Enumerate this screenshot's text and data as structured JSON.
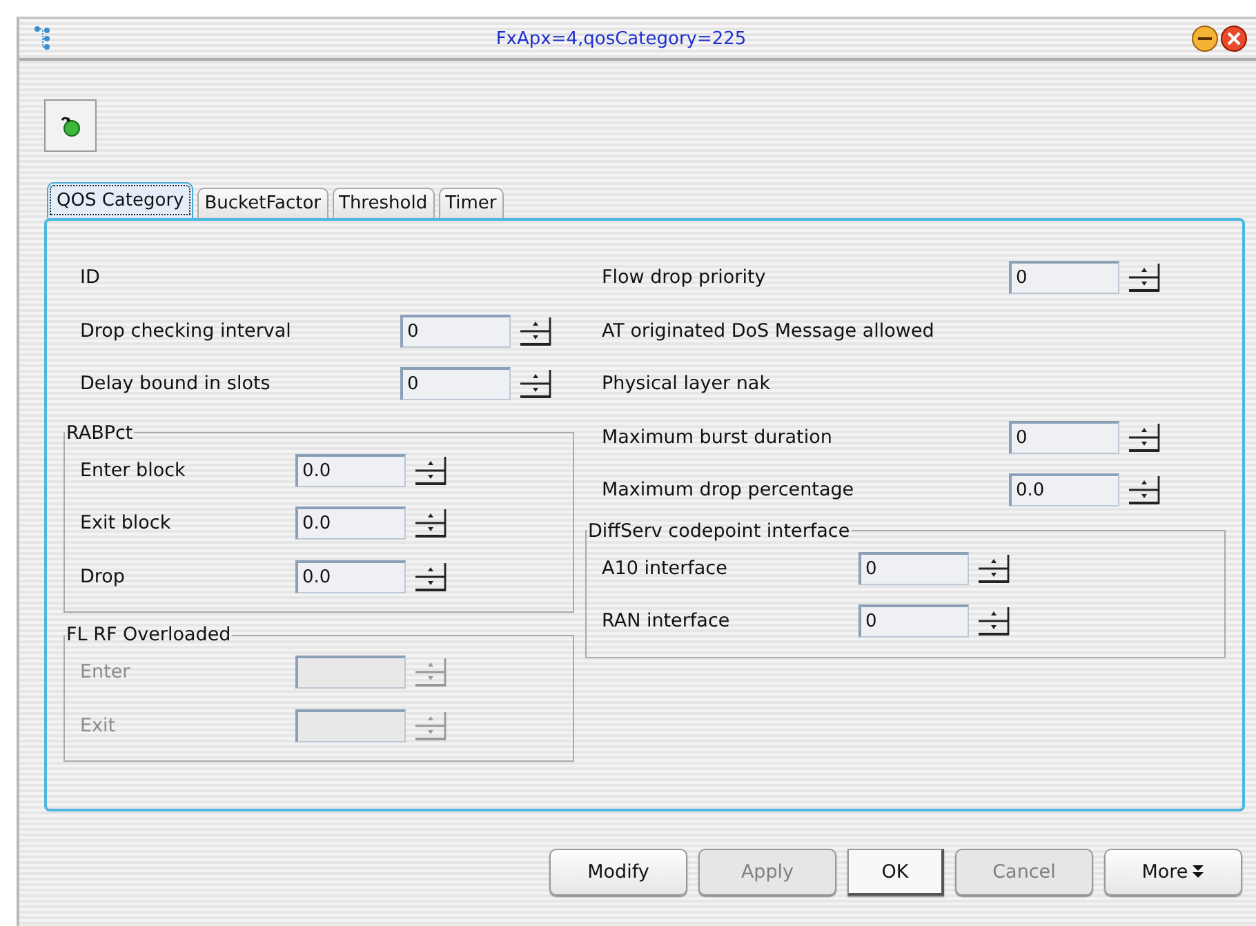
{
  "window": {
    "title": "FxApx=4,qosCategory=225"
  },
  "tabs": [
    {
      "label": "QOS Category",
      "selected": true
    },
    {
      "label": "BucketFactor",
      "selected": false
    },
    {
      "label": "Threshold",
      "selected": false
    },
    {
      "label": "Timer",
      "selected": false
    }
  ],
  "left_fields": [
    {
      "kind": "text",
      "label": "ID",
      "disabled": false
    },
    {
      "kind": "spinner",
      "label": "Drop checking interval",
      "value": "0",
      "disabled": false
    },
    {
      "kind": "spinner",
      "label": "Delay bound in slots",
      "value": "0",
      "disabled": false
    }
  ],
  "left_groups": [
    {
      "title": "RABPct",
      "fields": [
        {
          "kind": "spinner",
          "label": "Enter block",
          "value": "0.0",
          "disabled": false
        },
        {
          "kind": "spinner",
          "label": "Exit block",
          "value": "0.0",
          "disabled": false
        },
        {
          "kind": "spinner",
          "label": "Drop",
          "value": "0.0",
          "disabled": false
        }
      ]
    },
    {
      "title": "FL RF Overloaded",
      "fields": [
        {
          "kind": "spinner",
          "label": "Enter",
          "disabled": true
        },
        {
          "kind": "spinner",
          "label": "Exit",
          "disabled": true
        }
      ]
    }
  ],
  "right_fields": [
    {
      "kind": "spinner",
      "label": "Flow drop priority",
      "value": "0",
      "disabled": false
    },
    {
      "kind": "text",
      "label": "AT originated DoS Message allowed",
      "disabled": false
    },
    {
      "kind": "text",
      "label": "Physical layer nak",
      "disabled": false
    },
    {
      "kind": "spinner",
      "label": "Maximum burst duration",
      "value": "0",
      "disabled": false
    },
    {
      "kind": "spinner",
      "label": "Maximum drop percentage",
      "value": "0.0",
      "disabled": false
    }
  ],
  "right_groups": [
    {
      "title": "DiffServ codepoint interface",
      "fields": [
        {
          "kind": "spinner",
          "label": "A10 interface",
          "value": "0",
          "disabled": false
        },
        {
          "kind": "spinner",
          "label": "RAN interface",
          "value": "0",
          "disabled": false
        }
      ]
    }
  ],
  "buttons": [
    {
      "kind": "normal",
      "label": "Modify",
      "disabled": false
    },
    {
      "kind": "normal",
      "label": "Apply",
      "disabled": true
    },
    {
      "kind": "default",
      "label": "OK",
      "disabled": false
    },
    {
      "kind": "normal",
      "label": "Cancel",
      "disabled": true
    },
    {
      "kind": "more",
      "label": "More",
      "disabled": false
    }
  ]
}
